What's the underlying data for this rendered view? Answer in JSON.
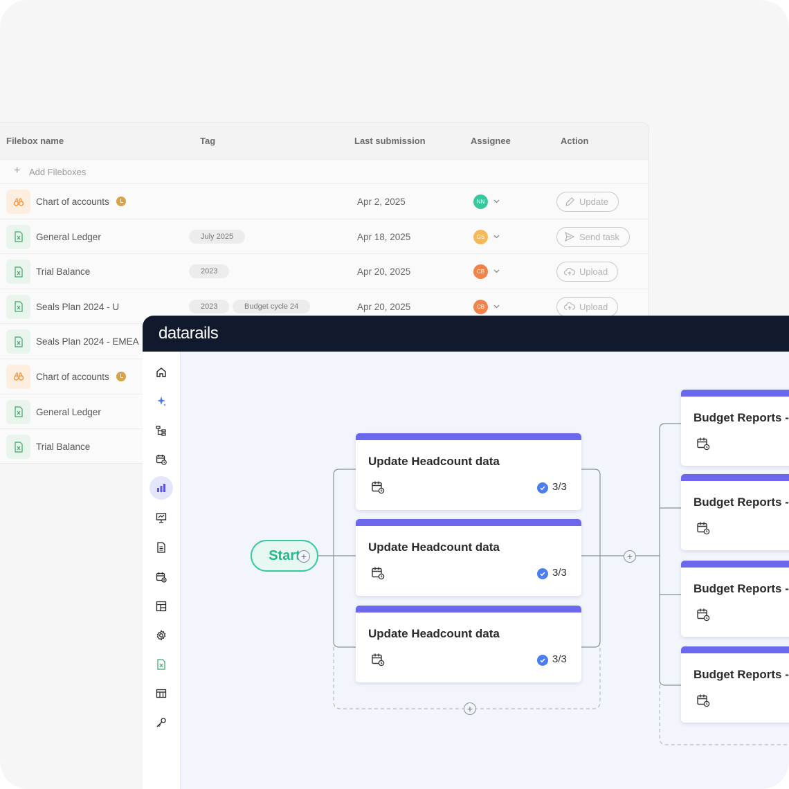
{
  "filebox_table": {
    "columns": [
      "Filebox name",
      "Tag",
      "Last submission",
      "Assignee",
      "Action"
    ],
    "add_label": "Add Fileboxes",
    "rows": [
      {
        "icon": "binoculars-icon",
        "name": "Chart of accounts",
        "clock": true,
        "tags": [],
        "date": "Apr 2, 2025",
        "assignee": {
          "initials": "NN",
          "color": "#36c9a0"
        },
        "action": {
          "label": "Update",
          "icon": "edit-pen-icon"
        }
      },
      {
        "icon": "excel-file-icon",
        "name": "General Ledger",
        "clock": false,
        "tags": [
          "July 2025"
        ],
        "date": "Apr 18, 2025",
        "assignee": {
          "initials": "GS",
          "color": "#f5b95a"
        },
        "action": {
          "label": "Send task",
          "icon": "send-icon"
        }
      },
      {
        "icon": "excel-file-icon",
        "name": "Trial Balance",
        "clock": false,
        "tags": [
          "2023"
        ],
        "date": "Apr 20, 2025",
        "assignee": {
          "initials": "CB",
          "color": "#f0834a"
        },
        "action": {
          "label": "Upload",
          "icon": "cloud-upload-icon"
        }
      },
      {
        "icon": "excel-file-icon",
        "name": "Seals Plan 2024 - U",
        "clock": false,
        "tags": [
          "2023",
          "Budget cycle 24"
        ],
        "date": "Apr 20, 2025",
        "assignee": {
          "initials": "CB",
          "color": "#f0834a"
        },
        "action": {
          "label": "Upload",
          "icon": "cloud-upload-icon"
        }
      },
      {
        "icon": "excel-file-icon",
        "name": "Seals Plan 2024 - EMEA",
        "clock": false,
        "tags": [],
        "date": "",
        "assignee": null,
        "action": null
      },
      {
        "icon": "binoculars-icon",
        "name": "Chart of accounts",
        "clock": true,
        "tags": [],
        "date": "",
        "assignee": null,
        "action": null
      },
      {
        "icon": "excel-file-icon",
        "name": "General Ledger",
        "clock": false,
        "tags": [],
        "date": "",
        "assignee": null,
        "action": null
      },
      {
        "icon": "excel-file-icon",
        "name": "Trial Balance",
        "clock": false,
        "tags": [],
        "date": "",
        "assignee": null,
        "action": null
      }
    ]
  },
  "app": {
    "logo": "datarails",
    "sidebar_icons": [
      "home-icon",
      "sparkle-icon",
      "hierarchy-icon",
      "calendar-clock-icon",
      "bar-chart-icon",
      "presentation-icon",
      "document-icon",
      "calendar-settings-icon",
      "layout-icon",
      "gear-icon",
      "excel-file-icon",
      "table-icon",
      "key-icon"
    ],
    "sidebar_active": "bar-chart-icon",
    "colors": {
      "accent": "#6c68ee",
      "start": "#36c9a0",
      "topbar": "#111a2c",
      "check": "#4b7cf0"
    },
    "workflow": {
      "start_label": "Start",
      "tasks": [
        {
          "title": "Update Headcount data",
          "count": "3/3"
        },
        {
          "title": "Update Headcount data",
          "count": "3/3"
        },
        {
          "title": "Update Headcount data",
          "count": "3/3"
        }
      ],
      "next_tasks": [
        {
          "title": "Budget Reports -"
        },
        {
          "title": "Budget Reports -"
        },
        {
          "title": "Budget Reports -"
        },
        {
          "title": "Budget Reports -"
        }
      ]
    }
  }
}
